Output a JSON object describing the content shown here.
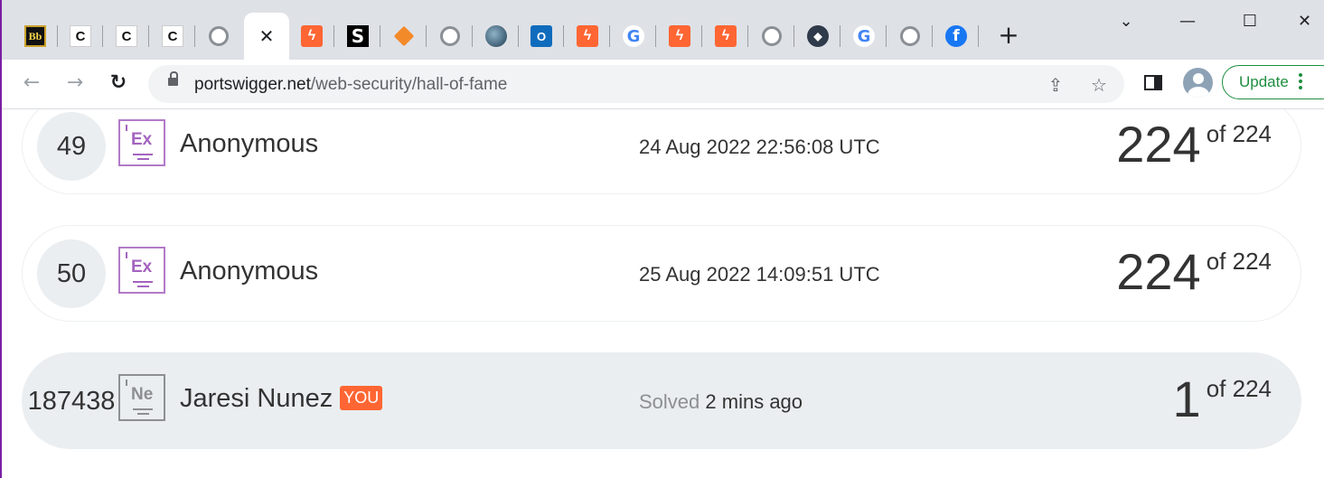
{
  "browser": {
    "tabs": [
      {
        "icon": "blackboard-icon",
        "glyph": "Bb"
      },
      {
        "icon": "codecademy-icon",
        "glyph": "C"
      },
      {
        "icon": "codecademy-icon",
        "glyph": "C"
      },
      {
        "icon": "codecademy-icon",
        "glyph": "C"
      },
      {
        "icon": "github-icon",
        "glyph": ""
      },
      {
        "icon": "close-icon",
        "glyph": "✕",
        "active": true
      },
      {
        "icon": "portswigger-icon",
        "glyph": "ϟ"
      },
      {
        "icon": "scribd-icon",
        "glyph": "S"
      },
      {
        "icon": "diamond-icon",
        "glyph": ""
      },
      {
        "icon": "github-icon",
        "glyph": ""
      },
      {
        "icon": "globe-icon",
        "glyph": ""
      },
      {
        "icon": "outlook-icon",
        "glyph": "O"
      },
      {
        "icon": "portswigger-icon",
        "glyph": "ϟ"
      },
      {
        "icon": "google-icon",
        "glyph": "G"
      },
      {
        "icon": "portswigger-icon",
        "glyph": "ϟ"
      },
      {
        "icon": "portswigger-icon",
        "glyph": "ϟ"
      },
      {
        "icon": "github-icon",
        "glyph": ""
      },
      {
        "icon": "docker-icon",
        "glyph": "◆"
      },
      {
        "icon": "google-icon",
        "glyph": "G"
      },
      {
        "icon": "github-icon",
        "glyph": ""
      },
      {
        "icon": "facebook-icon",
        "glyph": "f"
      }
    ],
    "new_tab_glyph": "+",
    "window": {
      "dropdown": "⌄",
      "minimize": "—",
      "maximize": "☐",
      "close": "✕"
    },
    "nav": {
      "back": "←",
      "forward": "→",
      "reload": "↻"
    },
    "url": {
      "host": "portswigger.net",
      "path": "/web-security/hall-of-fame"
    },
    "omnibox_icons": {
      "share": "⇪",
      "star": "☆"
    },
    "update_label": "Update"
  },
  "leaderboard": [
    {
      "rank": "49",
      "badge": "Ex",
      "name": "Anonymous",
      "you": "",
      "when_label": "",
      "when": "24 Aug 2022 22:56:08 UTC",
      "solved": "224",
      "of": "of 224",
      "me": false
    },
    {
      "rank": "50",
      "badge": "Ex",
      "name": "Anonymous",
      "you": "",
      "when_label": "",
      "when": "25 Aug 2022 14:09:51 UTC",
      "solved": "224",
      "of": "of 224",
      "me": false
    },
    {
      "rank": "187438",
      "badge": "Ne",
      "name": "Jaresi Nunez",
      "you": "YOU",
      "when_label": "Solved",
      "when": "2 mins ago",
      "solved": "1",
      "of": "of 224",
      "me": true
    }
  ]
}
